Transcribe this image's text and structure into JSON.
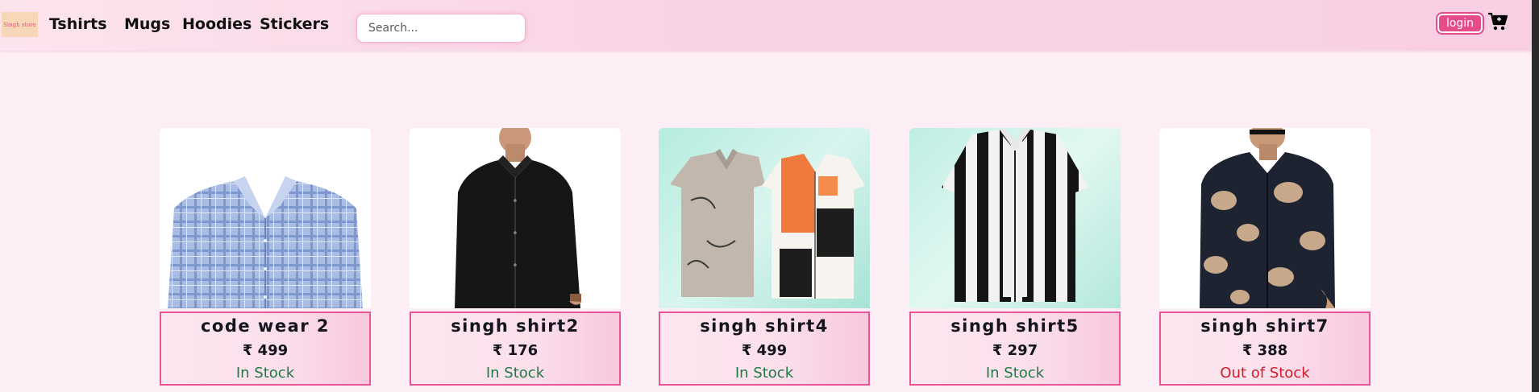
{
  "navbar": {
    "logo_text": "Singh store",
    "links": [
      "Tshirts",
      "Mugs",
      "Hoodies",
      "Stickers"
    ],
    "search_placeholder": "Search...",
    "login_label": "login",
    "cart_icon": "cart-icon"
  },
  "colors": {
    "accent": "#e64b8b",
    "in_stock": "#1e7b45",
    "out_of_stock": "#d11b2a"
  },
  "products": [
    {
      "title": "code wear 2",
      "price": "₹ 499",
      "stock": "In Stock",
      "in_stock": true,
      "image": "blue-plaid-shirt"
    },
    {
      "title": "singh shirt2",
      "price": "₹ 176",
      "stock": "In Stock",
      "in_stock": true,
      "image": "black-shirt-model"
    },
    {
      "title": "singh shirt4",
      "price": "₹ 499",
      "stock": "In Stock",
      "in_stock": true,
      "image": "printed-shirt-pair"
    },
    {
      "title": "singh shirt5",
      "price": "₹ 297",
      "stock": "In Stock",
      "in_stock": true,
      "image": "striped-shirt"
    },
    {
      "title": "singh shirt7",
      "price": "₹ 388",
      "stock": "Out of Stock",
      "in_stock": false,
      "image": "floral-shirt-model"
    }
  ]
}
